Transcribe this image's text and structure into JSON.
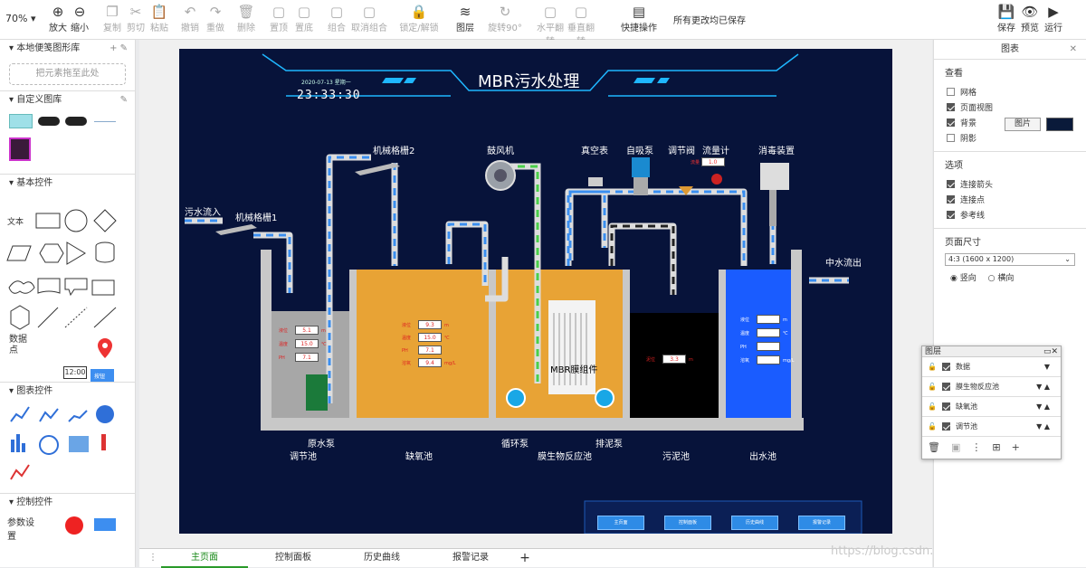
{
  "toolbar": {
    "zoom": "70%",
    "items": [
      {
        "label": "放大",
        "icon": "zoom-in-icon"
      },
      {
        "label": "缩小",
        "icon": "zoom-out-icon"
      },
      {
        "label": "复制",
        "icon": "copy-icon"
      },
      {
        "label": "剪切",
        "icon": "cut-icon"
      },
      {
        "label": "粘贴",
        "icon": "paste-icon"
      },
      {
        "label": "撤销",
        "icon": "undo-icon"
      },
      {
        "label": "重做",
        "icon": "redo-icon"
      },
      {
        "label": "删除",
        "icon": "delete-icon"
      },
      {
        "label": "置顶",
        "icon": "bring-front-icon"
      },
      {
        "label": "置底",
        "icon": "send-back-icon"
      },
      {
        "label": "组合",
        "icon": "group-icon"
      },
      {
        "label": "取消组合",
        "icon": "ungroup-icon"
      },
      {
        "label": "锁定/解锁",
        "icon": "lock-icon"
      },
      {
        "label": "图层",
        "icon": "layers-icon"
      },
      {
        "label": "旋转90°",
        "icon": "rotate-icon"
      },
      {
        "label": "水平翻转",
        "icon": "flip-h-icon"
      },
      {
        "label": "垂直翻转",
        "icon": "flip-v-icon"
      },
      {
        "label": "快捷操作",
        "icon": "quick-action-icon"
      }
    ],
    "status": "所有更改均已保存",
    "right": [
      {
        "label": "保存",
        "icon": "save-icon"
      },
      {
        "label": "预览",
        "icon": "preview-icon"
      },
      {
        "label": "运行",
        "icon": "run-icon"
      }
    ]
  },
  "sidebar": {
    "sections": [
      "本地便笺图形库",
      "自定义图库",
      "基本控件",
      "图表控件",
      "控制控件"
    ],
    "dropzone": "把元素拖至此处",
    "basic_text": "文本",
    "data_point": "数据点",
    "ctrl_label": "参数设置",
    "clock_text": "12:00",
    "small_btn": "按钮"
  },
  "scada": {
    "title": "MBR污水处理",
    "date": "2020-07-13  星期一",
    "time": "23:33:30",
    "labels": {
      "inflow": "污水流入",
      "grid1": "机械格栅1",
      "grid2": "机械格栅2",
      "blower": "鼓风机",
      "vacuum": "真空表",
      "selfpump": "自吸泵",
      "valve": "调节阀",
      "flowmeter": "流量计",
      "disinfect": "消毒装置",
      "outflow": "中水流出",
      "rawpump": "原水泵",
      "circpump": "循环泵",
      "mudpump": "排泥泵",
      "membrane": "MBR膜组件",
      "tank1": "调节池",
      "tank2": "缺氧池",
      "tank3": "膜生物反应池",
      "tank4": "污泥池",
      "tank5": "出水池",
      "flow_tag": "流量",
      "flow_val": "1.0"
    },
    "tank1_fields": [
      {
        "label": "液位",
        "value": "5.1",
        "unit": "m"
      },
      {
        "label": "温度",
        "value": "15.0",
        "unit": "℃"
      },
      {
        "label": "PH",
        "value": "7.1",
        "unit": ""
      }
    ],
    "tank2_fields": [
      {
        "label": "液位",
        "value": "9.3",
        "unit": "m"
      },
      {
        "label": "温度",
        "value": "15.0",
        "unit": "℃"
      },
      {
        "label": "PH",
        "value": "7.1",
        "unit": ""
      },
      {
        "label": "溶氧",
        "value": "9.4",
        "unit": "mg/L"
      }
    ],
    "tank4_fields": [
      {
        "label": "泥位",
        "value": "3.3",
        "unit": "m"
      }
    ],
    "tank5_fields": [
      {
        "label": "液位",
        "value": "10.0",
        "unit": "m"
      },
      {
        "label": "温度",
        "value": "15.0",
        "unit": "℃"
      },
      {
        "label": "PH",
        "value": "6.5",
        "unit": ""
      },
      {
        "label": "溶氧",
        "value": "10.0",
        "unit": "mg/L"
      }
    ],
    "nav": [
      "主页面",
      "控制面板",
      "历史曲线",
      "报警记录"
    ]
  },
  "right_panel": {
    "title": "图表",
    "view_title": "查看",
    "view_items": [
      {
        "label": "网格",
        "checked": false
      },
      {
        "label": "页面视图",
        "checked": true
      },
      {
        "label": "背景",
        "checked": true
      },
      {
        "label": "阴影",
        "checked": false
      }
    ],
    "image_button": "图片",
    "options_title": "选项",
    "options_items": [
      {
        "label": "连接箭头",
        "checked": true
      },
      {
        "label": "连接点",
        "checked": true
      },
      {
        "label": "参考线",
        "checked": true
      }
    ],
    "page_size_title": "页面尺寸",
    "page_size_value": "4:3 (1600 x 1200)",
    "portrait": "竖向",
    "landscape": "横向"
  },
  "layers_panel": {
    "title": "图层",
    "rows": [
      "数据",
      "膜生物反应池",
      "缺氧池",
      "调节池"
    ]
  },
  "tabs": [
    "主页面",
    "控制面板",
    "历史曲线",
    "报警记录"
  ],
  "watermark": "https://blog.csdn.net/weixin_44384639",
  "colors": {
    "page_bg": "#07133a",
    "tank_orange": "#e8a335",
    "tank_grey": "#a7a7a7",
    "tank_blue": "#1a5cff",
    "pipe_blue": "#3a8ef0",
    "accent_green": "#2a9a2a"
  }
}
